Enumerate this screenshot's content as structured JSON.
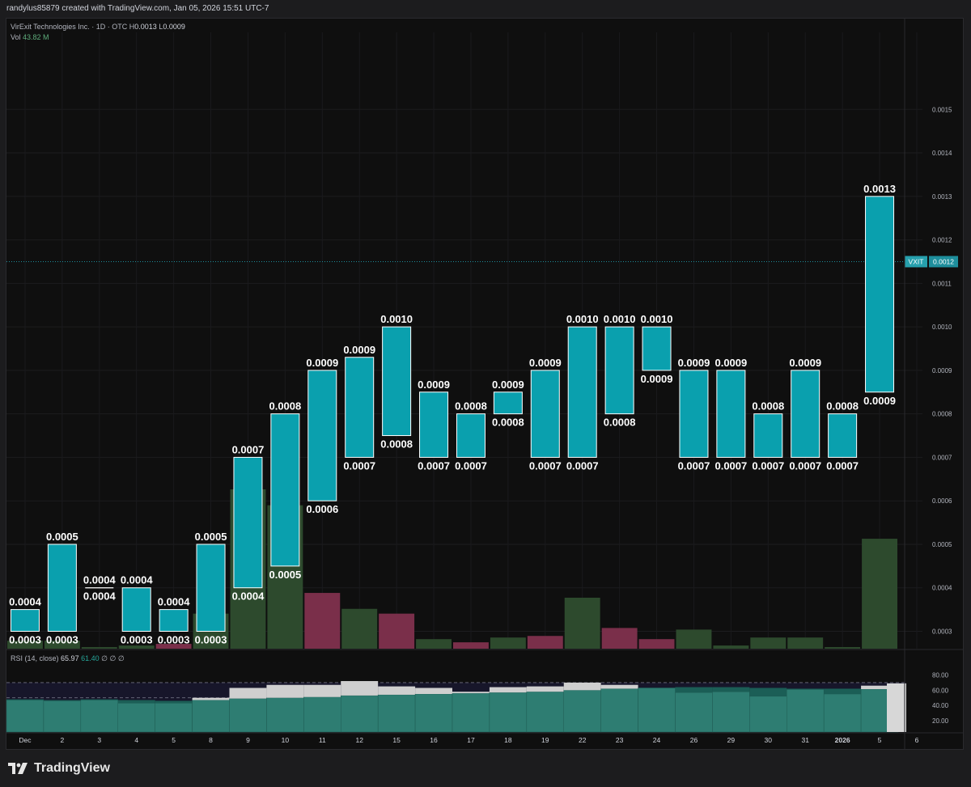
{
  "header": {
    "credit": "randylus85879 created with TradingView.com, Jan 05, 2026 15:51 UTC-7"
  },
  "legend": {
    "symbol_line": "VirExit Technologies Inc. · 1D · OTC",
    "h_label": "H",
    "h_value": "0.0013",
    "l_label": "L",
    "l_value": "0.0009",
    "vol_label": "Vol",
    "vol_value": "43.82 M"
  },
  "rsi_legend": {
    "label": "RSI (14, close)",
    "value": "65.97",
    "ma_value": "61.40",
    "extra1": "∅",
    "extra2": "∅",
    "extra3": "∅"
  },
  "price_badge": {
    "ticker": "VXIT",
    "price": "0.0012",
    "ticker_color": "#26a0ad",
    "price_color": "#1e8e9c"
  },
  "footer": {
    "brand": "TradingView"
  },
  "colors": {
    "box": "#0aa0ae",
    "box_border": "#ffffff",
    "vol_up": "#2d4a2d",
    "vol_down": "#7a2f4a",
    "rsi_fill": "#2e7d72",
    "rsi_above": "#cfcfcf"
  },
  "chart_data": {
    "type": "bar",
    "price_axis": {
      "ticks": [
        "0.0015",
        "0.0014",
        "0.0013",
        "0.0012",
        "0.0011",
        "0.0010",
        "0.0009",
        "0.0008",
        "0.0007",
        "0.0006",
        "0.0005",
        "0.0004",
        "0.0003"
      ],
      "range": [
        0.00026,
        0.00164
      ]
    },
    "rsi_axis": {
      "ticks": [
        "80.00",
        "60.00",
        "40.00",
        "20.00"
      ],
      "range": [
        5,
        88
      ],
      "bands": [
        70,
        50,
        30
      ]
    },
    "x_axis": {
      "labels": [
        "Dec",
        "2",
        "3",
        "4",
        "5",
        "8",
        "9",
        "10",
        "11",
        "12",
        "15",
        "16",
        "17",
        "18",
        "19",
        "22",
        "23",
        "24",
        "26",
        "29",
        "30",
        "31",
        "2026",
        "5",
        "6"
      ]
    },
    "current_price": 0.00115,
    "boxes": [
      {
        "x": "Dec",
        "low": 0.0003,
        "high": 0.00035,
        "low_label": "0.0003",
        "high_label": "0.0004"
      },
      {
        "x": "2",
        "low": 0.0003,
        "high": 0.0005,
        "low_label": "0.0003",
        "high_label": "0.0005"
      },
      {
        "x": "3",
        "low": 0.0004,
        "high": 0.0004,
        "low_label": "0.0004",
        "high_label": "0.0004"
      },
      {
        "x": "4",
        "low": 0.0003,
        "high": 0.0004,
        "low_label": "0.0003",
        "high_label": "0.0004"
      },
      {
        "x": "5",
        "low": 0.0003,
        "high": 0.00035,
        "low_label": "0.0003",
        "high_label": "0.0004"
      },
      {
        "x": "8",
        "low": 0.0003,
        "high": 0.0005,
        "low_label": "0.0003",
        "high_label": "0.0005"
      },
      {
        "x": "9",
        "low": 0.0004,
        "high": 0.0007,
        "low_label": "0.0004",
        "high_label": "0.0007"
      },
      {
        "x": "10",
        "low": 0.00045,
        "high": 0.0008,
        "low_label": "0.0005",
        "high_label": "0.0008"
      },
      {
        "x": "11",
        "low": 0.0006,
        "high": 0.0009,
        "low_label": "0.0006",
        "high_label": "0.0009"
      },
      {
        "x": "12",
        "low": 0.0007,
        "high": 0.00093,
        "low_label": "0.0007",
        "high_label": "0.0009"
      },
      {
        "x": "15",
        "low": 0.00075,
        "high": 0.001,
        "low_label": "0.0008",
        "high_label": "0.0010"
      },
      {
        "x": "16",
        "low": 0.0007,
        "high": 0.00085,
        "low_label": "0.0007",
        "high_label": "0.0009"
      },
      {
        "x": "17",
        "low": 0.0007,
        "high": 0.0008,
        "low_label": "0.0007",
        "high_label": "0.0008"
      },
      {
        "x": "18",
        "low": 0.0008,
        "high": 0.00085,
        "low_label": "0.0008",
        "high_label": "0.0009"
      },
      {
        "x": "19",
        "low": 0.0007,
        "high": 0.0009,
        "low_label": "0.0007",
        "high_label": "0.0009"
      },
      {
        "x": "22",
        "low": 0.0007,
        "high": 0.001,
        "low_label": "0.0007",
        "high_label": "0.0010"
      },
      {
        "x": "23",
        "low": 0.0008,
        "high": 0.001,
        "low_label": "0.0008",
        "high_label": "0.0010"
      },
      {
        "x": "24",
        "low": 0.0009,
        "high": 0.001,
        "low_label": "0.0009",
        "high_label": "0.0010"
      },
      {
        "x": "26",
        "low": 0.0007,
        "high": 0.0009,
        "low_label": "0.0007",
        "high_label": "0.0009"
      },
      {
        "x": "29",
        "low": 0.0007,
        "high": 0.0009,
        "low_label": "0.0007",
        "high_label": "0.0009"
      },
      {
        "x": "30",
        "low": 0.0007,
        "high": 0.0008,
        "low_label": "0.0007",
        "high_label": "0.0008"
      },
      {
        "x": "31",
        "low": 0.0007,
        "high": 0.0009,
        "low_label": "0.0007",
        "high_label": "0.0009"
      },
      {
        "x": "2026",
        "low": 0.0007,
        "high": 0.0008,
        "low_label": "0.0007",
        "high_label": "0.0008"
      },
      {
        "x": "5",
        "low": 0.00085,
        "high": 0.0013,
        "low_label": "0.0009",
        "high_label": "0.0013"
      }
    ],
    "volume": [
      {
        "v": 0.05,
        "dir": "up"
      },
      {
        "v": 0.05,
        "dir": "up"
      },
      {
        "v": 0.01,
        "dir": "up"
      },
      {
        "v": 0.02,
        "dir": "up"
      },
      {
        "v": 0.03,
        "dir": "down"
      },
      {
        "v": 0.22,
        "dir": "up"
      },
      {
        "v": 1.0,
        "dir": "up"
      },
      {
        "v": 0.9,
        "dir": "up"
      },
      {
        "v": 0.35,
        "dir": "down"
      },
      {
        "v": 0.25,
        "dir": "up"
      },
      {
        "v": 0.22,
        "dir": "down"
      },
      {
        "v": 0.06,
        "dir": "up"
      },
      {
        "v": 0.04,
        "dir": "down"
      },
      {
        "v": 0.07,
        "dir": "up"
      },
      {
        "v": 0.08,
        "dir": "down"
      },
      {
        "v": 0.32,
        "dir": "up"
      },
      {
        "v": 0.13,
        "dir": "down"
      },
      {
        "v": 0.06,
        "dir": "down"
      },
      {
        "v": 0.12,
        "dir": "up"
      },
      {
        "v": 0.02,
        "dir": "up"
      },
      {
        "v": 0.07,
        "dir": "up"
      },
      {
        "v": 0.07,
        "dir": "up"
      },
      {
        "v": 0.01,
        "dir": "up"
      },
      {
        "v": 0.69,
        "dir": "up"
      }
    ],
    "rsi": [
      {
        "rsi": 47,
        "ma": 48
      },
      {
        "rsi": 46,
        "ma": 47
      },
      {
        "rsi": 47,
        "ma": 48
      },
      {
        "rsi": 43,
        "ma": 47
      },
      {
        "rsi": 43,
        "ma": 46
      },
      {
        "rsi": 50,
        "ma": 47
      },
      {
        "rsi": 63,
        "ma": 49
      },
      {
        "rsi": 67,
        "ma": 50
      },
      {
        "rsi": 67,
        "ma": 51
      },
      {
        "rsi": 72,
        "ma": 53
      },
      {
        "rsi": 65,
        "ma": 54
      },
      {
        "rsi": 63,
        "ma": 55
      },
      {
        "rsi": 58,
        "ma": 56
      },
      {
        "rsi": 64,
        "ma": 57
      },
      {
        "rsi": 65,
        "ma": 58
      },
      {
        "rsi": 70,
        "ma": 60
      },
      {
        "rsi": 67,
        "ma": 62
      },
      {
        "rsi": 63,
        "ma": 63
      },
      {
        "rsi": 57,
        "ma": 64
      },
      {
        "rsi": 58,
        "ma": 64
      },
      {
        "rsi": 52,
        "ma": 63
      },
      {
        "rsi": 61,
        "ma": 62
      },
      {
        "rsi": 55,
        "ma": 62
      },
      {
        "rsi": 65.97,
        "ma": 61.4
      }
    ]
  }
}
